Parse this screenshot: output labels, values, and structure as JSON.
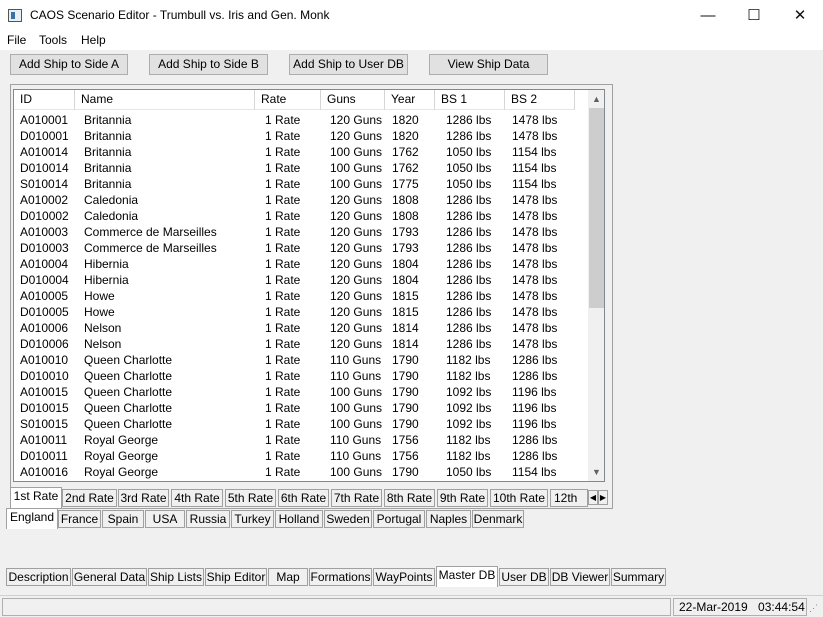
{
  "window": {
    "title": "CAOS Scenario Editor - Trumbull vs. Iris and Gen. Monk",
    "minimize": "—",
    "maximize": "☐",
    "close": "✕"
  },
  "menu": [
    "File",
    "Tools",
    "Help"
  ],
  "toolbar": {
    "add_side_a": "Add Ship to Side A",
    "add_side_b": "Add Ship to Side B",
    "add_user_db": "Add Ship to User DB",
    "view_ship_data": "View Ship Data"
  },
  "table": {
    "columns": [
      "ID",
      "Name",
      "Rate",
      "Guns",
      "Year",
      "BS 1",
      "BS 2"
    ],
    "rows": [
      [
        "A010001",
        "Britannia",
        "1 Rate",
        "120 Guns",
        "1820",
        "1286 lbs",
        "1478 lbs"
      ],
      [
        "D010001",
        "Britannia",
        "1 Rate",
        "120 Guns",
        "1820",
        "1286 lbs",
        "1478 lbs"
      ],
      [
        "A010014",
        "Britannia",
        "1 Rate",
        "100 Guns",
        "1762",
        "1050 lbs",
        "1154 lbs"
      ],
      [
        "D010014",
        "Britannia",
        "1 Rate",
        "100 Guns",
        "1762",
        "1050 lbs",
        "1154 lbs"
      ],
      [
        "S010014",
        "Britannia",
        "1 Rate",
        "100 Guns",
        "1775",
        "1050 lbs",
        "1154 lbs"
      ],
      [
        "A010002",
        "Caledonia",
        "1 Rate",
        "120 Guns",
        "1808",
        "1286 lbs",
        "1478 lbs"
      ],
      [
        "D010002",
        "Caledonia",
        "1 Rate",
        "120 Guns",
        "1808",
        "1286 lbs",
        "1478 lbs"
      ],
      [
        "A010003",
        "Commerce de Marseilles",
        "1 Rate",
        "120 Guns",
        "1793",
        "1286 lbs",
        "1478 lbs"
      ],
      [
        "D010003",
        "Commerce de Marseilles",
        "1 Rate",
        "120 Guns",
        "1793",
        "1286 lbs",
        "1478 lbs"
      ],
      [
        "A010004",
        "Hibernia",
        "1 Rate",
        "120 Guns",
        "1804",
        "1286 lbs",
        "1478 lbs"
      ],
      [
        "D010004",
        "Hibernia",
        "1 Rate",
        "120 Guns",
        "1804",
        "1286 lbs",
        "1478 lbs"
      ],
      [
        "A010005",
        "Howe",
        "1 Rate",
        "120 Guns",
        "1815",
        "1286 lbs",
        "1478 lbs"
      ],
      [
        "D010005",
        "Howe",
        "1 Rate",
        "120 Guns",
        "1815",
        "1286 lbs",
        "1478 lbs"
      ],
      [
        "A010006",
        "Nelson",
        "1 Rate",
        "120 Guns",
        "1814",
        "1286 lbs",
        "1478 lbs"
      ],
      [
        "D010006",
        "Nelson",
        "1 Rate",
        "120 Guns",
        "1814",
        "1286 lbs",
        "1478 lbs"
      ],
      [
        "A010010",
        "Queen Charlotte",
        "1 Rate",
        "110 Guns",
        "1790",
        "1182 lbs",
        "1286 lbs"
      ],
      [
        "D010010",
        "Queen Charlotte",
        "1 Rate",
        "110 Guns",
        "1790",
        "1182 lbs",
        "1286 lbs"
      ],
      [
        "A010015",
        "Queen Charlotte",
        "1 Rate",
        "100 Guns",
        "1790",
        "1092 lbs",
        "1196 lbs"
      ],
      [
        "D010015",
        "Queen Charlotte",
        "1 Rate",
        "100 Guns",
        "1790",
        "1092 lbs",
        "1196 lbs"
      ],
      [
        "S010015",
        "Queen Charlotte",
        "1 Rate",
        "100 Guns",
        "1790",
        "1092 lbs",
        "1196 lbs"
      ],
      [
        "A010011",
        "Royal George",
        "1 Rate",
        "110 Guns",
        "1756",
        "1182 lbs",
        "1286 lbs"
      ],
      [
        "D010011",
        "Royal George",
        "1 Rate",
        "110 Guns",
        "1756",
        "1182 lbs",
        "1286 lbs"
      ],
      [
        "A010016",
        "Royal George",
        "1 Rate",
        "100 Guns",
        "1790",
        "1050 lbs",
        "1154 lbs"
      ]
    ]
  },
  "rate_tabs": [
    "1st Rate",
    "2nd Rate",
    "3rd Rate",
    "4th Rate",
    "5th Rate",
    "6th Rate",
    "7th Rate",
    "8th Rate",
    "9th Rate",
    "10th Rate",
    "12th"
  ],
  "rate_tab_selected": "1st Rate",
  "nation_tabs": [
    "England",
    "France",
    "Spain",
    "USA",
    "Russia",
    "Turkey",
    "Holland",
    "Sweden",
    "Portugal",
    "Naples",
    "Denmark"
  ],
  "nation_tab_selected": "England",
  "main_tabs": [
    "Description",
    "General Data",
    "Ship Lists",
    "Ship Editor",
    "Map",
    "Formations",
    "WayPoints",
    "Master DB",
    "User DB",
    "DB Viewer",
    "Summary"
  ],
  "main_tab_selected": "Master DB",
  "icons": {
    "scroll_up": "▲",
    "scroll_down": "▼",
    "tab_left": "◀",
    "tab_right": "▶"
  },
  "status": {
    "date": "22-Mar-2019",
    "time": "03:44:54"
  }
}
